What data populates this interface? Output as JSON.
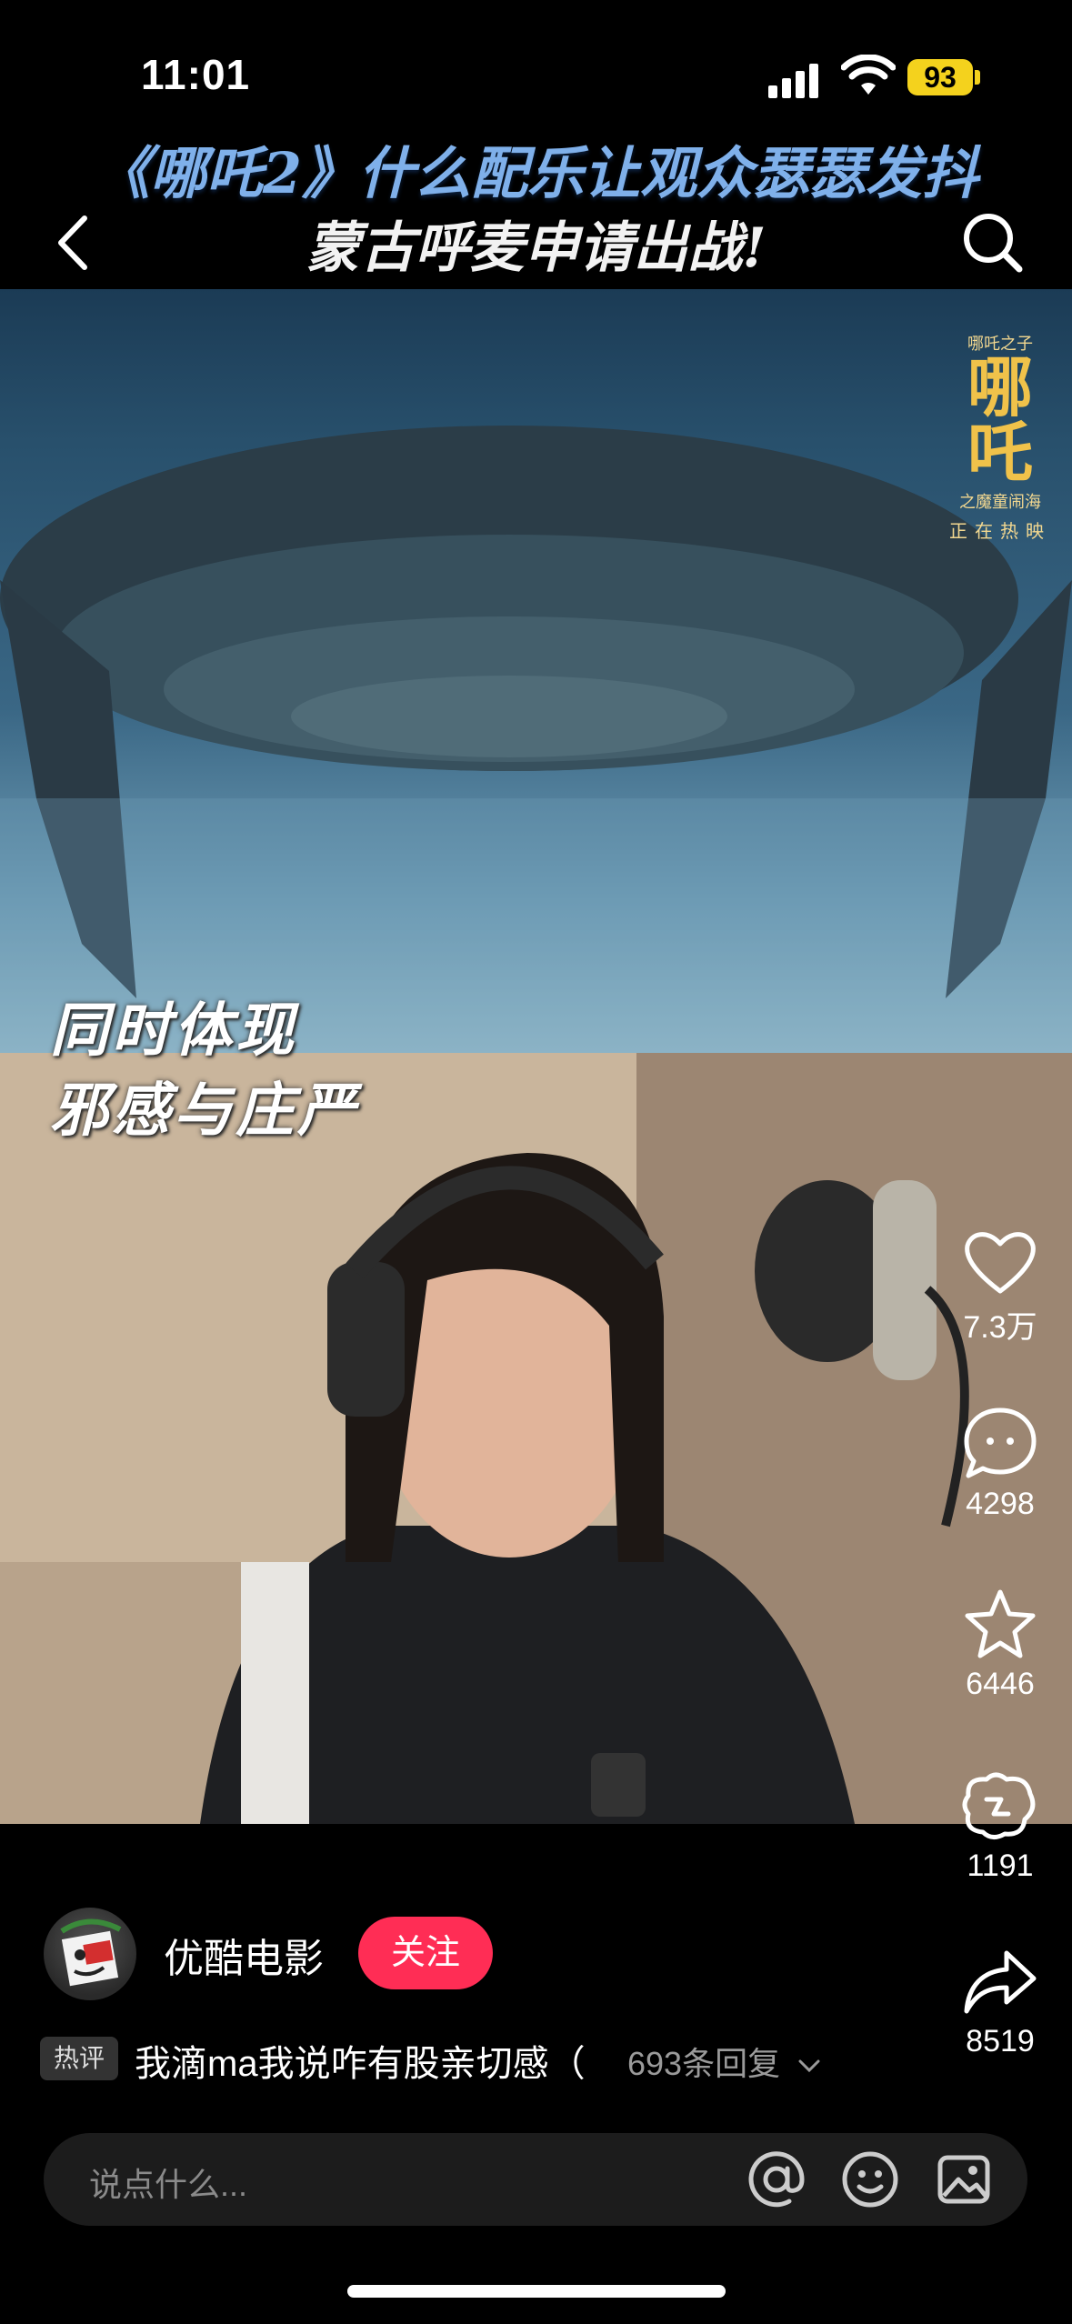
{
  "status_bar": {
    "time": "11:01",
    "battery": "93"
  },
  "header": {
    "title_line1": "《哪吒2》什么配乐让观众瑟瑟发抖",
    "title_line2": "蒙古呼麦申请出战!"
  },
  "video": {
    "caption_line1": "同时体现",
    "caption_line2": "邪感与庄严",
    "movie_logo": {
      "title": "哪吒",
      "subtitle": "之魔童闹海",
      "tagline": "正在热映",
      "corner": "哪吒之子"
    }
  },
  "actions": {
    "like_count": "7.3万",
    "comment_count": "4298",
    "favorite_count": "6446",
    "share_count": "1191",
    "forward_count": "8519"
  },
  "author": {
    "name": "优酷电影",
    "follow_label": "关注"
  },
  "hot_comment": {
    "tag": "热评",
    "text": "我滴ma我说咋有股亲切感（",
    "reply_count": "693条回复"
  },
  "input": {
    "placeholder": "说点什么..."
  },
  "colors": {
    "accent": "#ff2d55",
    "battery": "#f4d21d",
    "title_blue": "#7fb0ea"
  }
}
